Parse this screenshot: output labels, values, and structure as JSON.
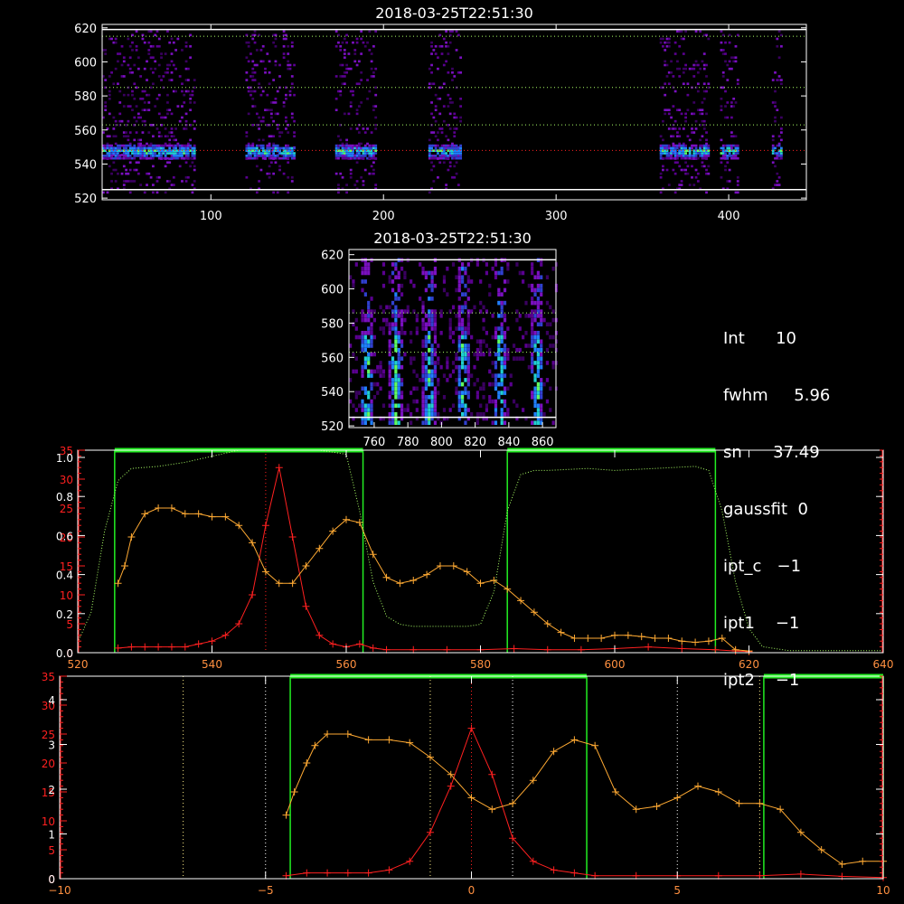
{
  "colors": {
    "background": "#000000",
    "axis": "#ffffff",
    "red": "#ff2020",
    "orange": "#ffaa33",
    "green": "#22ee22",
    "lightgreen": "#aaff66",
    "yellow_dotted": "#ffee88",
    "white_dotted": "#ffffff"
  },
  "info_panel": {
    "lines": [
      "Int      10",
      "fwhm     5.96",
      "sn      37.49",
      "gaussfit  0",
      "ipt_c   −1",
      "ipt1    −1",
      "ipt2    −1"
    ]
  },
  "chart_data": [
    {
      "type": "heatmap",
      "title": "2018-03-25T22:51:30",
      "x_ticks": [
        "100",
        "200",
        "300",
        "400"
      ],
      "y_ticks": [
        "620",
        "600",
        "580",
        "560",
        "540",
        "520"
      ],
      "xlim": [
        37,
        445
      ],
      "ylim": [
        519,
        622
      ],
      "bright_band_y": 548,
      "active_x_ranges": [
        [
          37,
          90
        ],
        [
          120,
          148
        ],
        [
          172,
          195
        ],
        [
          226,
          245
        ],
        [
          360,
          388
        ],
        [
          395,
          405
        ],
        [
          425,
          430
        ]
      ],
      "horizontal_lines": [
        {
          "y": 548,
          "style": "dotted",
          "color": "red"
        },
        {
          "y": 563,
          "style": "dotted",
          "color": "yellowgreen"
        },
        {
          "y": 585,
          "style": "dotted",
          "color": "yellowgreen"
        },
        {
          "y": 615,
          "style": "dotted",
          "color": "yellowgreen"
        },
        {
          "y": 525,
          "style": "solid",
          "color": "white"
        },
        {
          "y": 619,
          "style": "solid",
          "color": "white"
        }
      ],
      "grid": false
    },
    {
      "type": "heatmap",
      "title": "2018-03-25T22:51:30",
      "x_ticks": [
        "760",
        "780",
        "800",
        "820",
        "840",
        "860"
      ],
      "y_ticks": [
        "620",
        "600",
        "580",
        "560",
        "540",
        "520"
      ],
      "xlim": [
        745,
        868
      ],
      "ylim": [
        519,
        623
      ],
      "bright_columns_x": [
        755,
        772,
        792,
        812,
        834,
        856
      ],
      "grid": false
    },
    {
      "type": "line",
      "title": "",
      "xlabel": "",
      "ylabel": "",
      "x_ticks": [
        "520",
        "540",
        "560",
        "580",
        "600",
        "620",
        "640"
      ],
      "left_ticks_red": [
        "35",
        "30",
        "25",
        "20",
        "15",
        "10",
        "5",
        "0"
      ],
      "left_ticks_white": [
        "1.0",
        "0.8",
        "0.6",
        "0.4",
        "0.2",
        "0.0"
      ],
      "xlim": [
        520,
        640
      ],
      "ylim_red": [
        0,
        35
      ],
      "ylim_white": [
        0,
        1.0
      ],
      "series": [
        {
          "color": "red",
          "marker": "+",
          "x": [
            526,
            528,
            530,
            532,
            534,
            536,
            538,
            540,
            542,
            544,
            546,
            548,
            550,
            552,
            554,
            556,
            558,
            560,
            562,
            564,
            566,
            570,
            575,
            580,
            585,
            590,
            595,
            600,
            605,
            610,
            615,
            618,
            620
          ],
          "y": [
            0.8,
            1,
            1,
            1,
            1,
            1,
            1.5,
            2,
            3,
            5,
            10,
            22,
            32,
            20,
            8,
            3,
            1.5,
            1,
            1.5,
            0.8,
            0.5,
            0.5,
            0.5,
            0.5,
            0.7,
            0.5,
            0.5,
            0.7,
            1,
            0.7,
            0.5,
            0.3,
            0.2
          ]
        },
        {
          "color": "orange",
          "marker": "+",
          "x": [
            526,
            527,
            528,
            530,
            532,
            534,
            536,
            538,
            540,
            542,
            544,
            546,
            548,
            550,
            552,
            554,
            556,
            558,
            560,
            562,
            564,
            566,
            568,
            570,
            572,
            574,
            576,
            578,
            580,
            582,
            584,
            586,
            588,
            590,
            592,
            594,
            596,
            598,
            600,
            602,
            604,
            606,
            608,
            610,
            612,
            614,
            616,
            618,
            620
          ],
          "y": [
            12,
            15,
            20,
            24,
            25,
            25,
            24,
            24,
            23.5,
            23.5,
            22,
            19,
            14,
            12,
            12,
            15,
            18,
            21,
            23,
            22.5,
            17,
            13,
            12,
            12.5,
            13.5,
            15,
            15,
            14,
            12,
            12.5,
            11,
            9,
            7,
            5,
            3.5,
            2.5,
            2.5,
            2.5,
            3,
            3,
            2.8,
            2.5,
            2.5,
            2,
            1.8,
            2,
            2.5,
            0.5,
            0.3
          ]
        },
        {
          "color": "lightgreen",
          "style": "dotted",
          "axis": "white",
          "x": [
            520,
            522,
            524,
            526,
            528,
            532,
            536,
            540,
            544,
            548,
            552,
            556,
            560,
            562,
            564,
            566,
            568,
            570,
            574,
            578,
            580,
            582,
            584,
            586,
            588,
            590,
            596,
            600,
            606,
            612,
            614,
            616,
            618,
            620,
            622,
            626,
            630,
            634,
            640
          ],
          "y": [
            0.05,
            0.2,
            0.6,
            0.85,
            0.91,
            0.92,
            0.94,
            0.97,
            1.0,
            1.0,
            1.0,
            1.0,
            0.98,
            0.7,
            0.35,
            0.18,
            0.14,
            0.13,
            0.13,
            0.13,
            0.14,
            0.3,
            0.7,
            0.88,
            0.9,
            0.9,
            0.91,
            0.9,
            0.91,
            0.92,
            0.9,
            0.7,
            0.35,
            0.12,
            0.03,
            0.01,
            0.01,
            0.01,
            0.01
          ]
        }
      ],
      "green_windows": [
        [
          525.5,
          562.5
        ],
        [
          584,
          615
        ]
      ],
      "vertical_lines": [
        {
          "x": 548,
          "color": "red",
          "style": "dotted"
        }
      ],
      "grid": false
    },
    {
      "type": "line",
      "title": "",
      "xlabel": "",
      "ylabel": "",
      "x_ticks": [
        "−10",
        "−5",
        "0",
        "5",
        "10"
      ],
      "left_ticks_red": [
        "35",
        "30",
        "25",
        "20",
        "15",
        "10",
        "5",
        "0"
      ],
      "left_ticks_white": [
        "4",
        "3",
        "2",
        "1",
        "0"
      ],
      "xlim": [
        -10,
        10
      ],
      "ylim_red": [
        0,
        35
      ],
      "series": [
        {
          "color": "red",
          "marker": "+",
          "x": [
            -4.5,
            -4.0,
            -3.5,
            -3.0,
            -2.5,
            -2.0,
            -1.5,
            -1.0,
            -0.5,
            0.0,
            0.5,
            1.0,
            1.5,
            2.0,
            2.5,
            3.0,
            4.0,
            5.0,
            6.0,
            7.0,
            8.0,
            9.0,
            10.0
          ],
          "y": [
            0.5,
            1,
            1,
            1,
            1,
            1.5,
            3,
            8,
            16,
            26,
            18,
            7,
            3,
            1.5,
            1,
            0.5,
            0.5,
            0.5,
            0.5,
            0.5,
            0.8,
            0.4,
            0.2
          ]
        },
        {
          "color": "orange",
          "marker": "+",
          "x": [
            -4.5,
            -4.3,
            -4.0,
            -3.8,
            -3.5,
            -3.0,
            -2.5,
            -2.0,
            -1.5,
            -1.0,
            -0.5,
            0.0,
            0.5,
            1.0,
            1.5,
            2.0,
            2.5,
            3.0,
            3.5,
            4.0,
            4.5,
            5.0,
            5.5,
            6.0,
            6.5,
            7.0,
            7.5,
            8.0,
            8.5,
            9.0,
            9.5,
            10.0
          ],
          "y": [
            11,
            15,
            20,
            23,
            25,
            25,
            24,
            24,
            23.5,
            21,
            18,
            14,
            12,
            13,
            17,
            22,
            24,
            23,
            15,
            12,
            12.5,
            14,
            16,
            15,
            13,
            13,
            12,
            8,
            5,
            2.5,
            3,
            3
          ]
        }
      ],
      "green_windows": [
        [
          -4.4,
          2.8
        ],
        [
          7.1,
          10
        ]
      ],
      "vertical_lines": [
        {
          "x": 0,
          "color": "red",
          "style": "dotted"
        },
        {
          "x": -7,
          "color": "yellow",
          "style": "dotted"
        },
        {
          "x": -5,
          "color": "white",
          "style": "dotted"
        },
        {
          "x": -1,
          "color": "yellow",
          "style": "dotted"
        },
        {
          "x": 1,
          "color": "white",
          "style": "dotted"
        },
        {
          "x": 5,
          "color": "white",
          "style": "dotted"
        },
        {
          "x": 7,
          "color": "yellow",
          "style": "dotted"
        }
      ],
      "grid": false
    }
  ]
}
